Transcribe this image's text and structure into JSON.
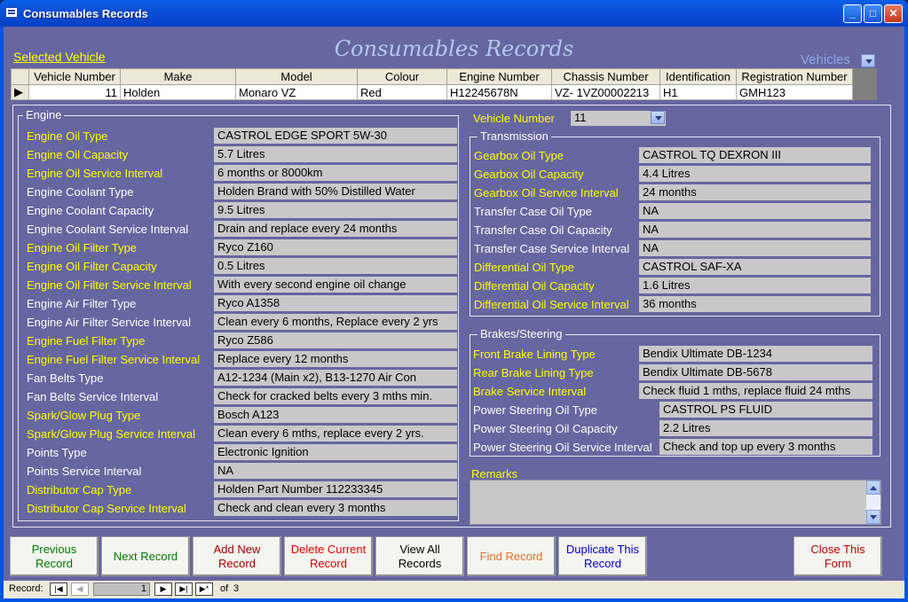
{
  "window": {
    "title": "Consumables Records"
  },
  "header": {
    "title": "Consumables Records",
    "selected_vehicle": "Selected Vehicle",
    "vehicles_label": "Vehicles"
  },
  "grid": {
    "columns": [
      "Vehicle Number",
      "Make",
      "Model",
      "Colour",
      "Engine Number",
      "Chassis Number",
      "Identification",
      "Registration Number"
    ],
    "row": [
      "11",
      "Holden",
      "Monaro VZ",
      "Red",
      "H12245678N",
      "VZ- 1VZ00002213",
      "H1",
      "GMH123"
    ]
  },
  "vehicle_number": {
    "label": "Vehicle Number",
    "value": "11"
  },
  "engine": {
    "legend": "Engine",
    "fields": [
      {
        "label": "Engine Oil Type",
        "value": "CASTROL EDGE SPORT 5W-30",
        "color": "yellow"
      },
      {
        "label": "Engine Oil Capacity",
        "value": "5.7 Litres",
        "color": "yellow"
      },
      {
        "label": "Engine Oil Service Interval",
        "value": "6 months or 8000km",
        "color": "yellow"
      },
      {
        "label": "Engine Coolant Type",
        "value": "Holden Brand with 50% Distilled Water",
        "color": "white"
      },
      {
        "label": "Engine Coolant Capacity",
        "value": "9.5 Litres",
        "color": "white"
      },
      {
        "label": "Engine Coolant Service Interval",
        "value": "Drain and replace every 24 months",
        "color": "white"
      },
      {
        "label": "Engine Oil Filter Type",
        "value": "Ryco Z160",
        "color": "yellow"
      },
      {
        "label": "Engine Oil Filter Capacity",
        "value": "0.5 Litres",
        "color": "yellow"
      },
      {
        "label": "Engine Oil Filter Service Interval",
        "value": "With every second engine oil change",
        "color": "yellow"
      },
      {
        "label": "Engine Air Filter Type",
        "value": "Ryco A1358",
        "color": "white"
      },
      {
        "label": "Engine Air Filter Service Interval",
        "value": "Clean every 6 months, Replace every 2 yrs",
        "color": "white"
      },
      {
        "label": "Engine Fuel Filter Type",
        "value": "Ryco Z586",
        "color": "yellow"
      },
      {
        "label": "Engine Fuel Filter Service Interval",
        "value": "Replace every 12 months",
        "color": "yellow"
      },
      {
        "label": "Fan Belts Type",
        "value": "A12-1234 (Main x2), B13-1270 Air Con",
        "color": "white"
      },
      {
        "label": "Fan Belts Service Interval",
        "value": "Check for cracked belts every 3 mths min.",
        "color": "white"
      },
      {
        "label": "Spark/Glow Plug Type",
        "value": "Bosch A123",
        "color": "yellow"
      },
      {
        "label": "Spark/Glow Plug Service Interval",
        "value": "Clean every 6 mths, replace every 2 yrs.",
        "color": "yellow"
      },
      {
        "label": "Points Type",
        "value": "Electronic Ignition",
        "color": "white"
      },
      {
        "label": "Points Service Interval",
        "value": "NA",
        "color": "white"
      },
      {
        "label": "Distributor Cap Type",
        "value": "Holden Part Number 112233345",
        "color": "yellow"
      },
      {
        "label": "Distributor Cap Service Interval",
        "value": "Check and clean every 3 months",
        "color": "yellow"
      }
    ]
  },
  "transmission": {
    "legend": "Transmission",
    "fields": [
      {
        "label": "Gearbox Oil Type",
        "value": "CASTROL TQ DEXRON III",
        "color": "yellow"
      },
      {
        "label": "Gearbox Oil Capacity",
        "value": "4.4 Litres",
        "color": "yellow"
      },
      {
        "label": "Gearbox Oil Service Interval",
        "value": "24 months",
        "color": "yellow"
      },
      {
        "label": "Transfer Case Oil Type",
        "value": "NA",
        "color": "white"
      },
      {
        "label": "Transfer Case Oil Capacity",
        "value": "NA",
        "color": "white"
      },
      {
        "label": "Transfer Case Service Interval",
        "value": "NA",
        "color": "white"
      },
      {
        "label": "Differential Oil Type",
        "value": "CASTROL SAF-XA",
        "color": "yellow"
      },
      {
        "label": "Differential Oil Capacity",
        "value": "1.6 Litres",
        "color": "yellow"
      },
      {
        "label": "Differential Oil Service Interval",
        "value": "36 months",
        "color": "yellow"
      }
    ]
  },
  "brakes": {
    "legend": "Brakes/Steering",
    "fields": [
      {
        "label": "Front Brake Lining Type",
        "value": "Bendix Ultimate DB-1234",
        "color": "yellow"
      },
      {
        "label": "Rear Brake Lining Type",
        "value": "Bendix Ultimate DB-5678",
        "color": "yellow"
      },
      {
        "label": "Brake Service Interval",
        "value": "Check fluid 1 mths, replace fluid 24 mths",
        "color": "yellow"
      },
      {
        "label": "Power Steering Oil Type",
        "value": "CASTROL PS FLUID",
        "color": "white"
      },
      {
        "label": "Power Steering Oil Capacity",
        "value": "2.2 Litres",
        "color": "white"
      },
      {
        "label": "Power Steering Oil Service Interval",
        "value": "Check and top up every 3 months",
        "color": "white"
      }
    ]
  },
  "remarks": {
    "label": "Remarks",
    "value": ""
  },
  "buttons": {
    "previous": "Previous Record",
    "next": "Next Record",
    "add": "Add New Record",
    "delete": "Delete Current Record",
    "view_all": "View All Records",
    "find": "Find Record",
    "duplicate": "Duplicate This Record",
    "close": "Close This Form"
  },
  "button_colors": {
    "previous": "#007800",
    "next": "#007800",
    "add": "#a00000",
    "delete": "#e00000",
    "view_all": "#000000",
    "find": "#e07020",
    "duplicate": "#0000c0",
    "close": "#c00000"
  },
  "statusbar": {
    "record_label": "Record:",
    "current": "1",
    "of_label": "of",
    "total": "3"
  },
  "colors": {
    "yellow": "#ffff00",
    "white": "#ffffff",
    "form_bg": "#6666a0"
  }
}
